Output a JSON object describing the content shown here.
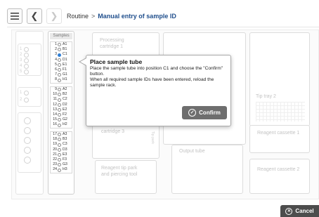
{
  "nav": {
    "menu_icon": "hamburger-menu-icon",
    "back_icon": "chevron-left-icon",
    "forward_icon": "chevron-right-icon"
  },
  "breadcrumb": {
    "root": "Routine",
    "separator": ">",
    "current": "Manual entry of sample ID"
  },
  "samples_panel": {
    "title": "Samples",
    "groups": [
      [
        {
          "n": "1",
          "pos": "A1"
        },
        {
          "n": "2",
          "pos": "B1"
        },
        {
          "n": "3",
          "pos": "C1",
          "active": true
        },
        {
          "n": "4",
          "pos": "D1"
        },
        {
          "n": "5",
          "pos": "E1"
        },
        {
          "n": "6",
          "pos": "F1"
        },
        {
          "n": "7",
          "pos": "G1"
        },
        {
          "n": "8",
          "pos": "H1"
        }
      ],
      [
        {
          "n": "9",
          "pos": "A2"
        },
        {
          "n": "10",
          "pos": "B2"
        },
        {
          "n": "11",
          "pos": "C2"
        },
        {
          "n": "12",
          "pos": "D2"
        },
        {
          "n": "13",
          "pos": "E2"
        },
        {
          "n": "14",
          "pos": "F2"
        },
        {
          "n": "15",
          "pos": "G2"
        },
        {
          "n": "16",
          "pos": "H2"
        }
      ],
      [
        {
          "n": "17",
          "pos": "A3"
        },
        {
          "n": "18",
          "pos": "B3"
        },
        {
          "n": "19",
          "pos": "C3"
        },
        {
          "n": "20",
          "pos": "D3"
        },
        {
          "n": "21",
          "pos": "E3"
        },
        {
          "n": "22",
          "pos": "F3"
        },
        {
          "n": "23",
          "pos": "G3"
        },
        {
          "n": "24",
          "pos": "H3"
        }
      ]
    ],
    "active_color": "#2f7fd6"
  },
  "modules": {
    "processing_cartridge_1": "Processing cartridge 1",
    "processing_cartridge_3": "cartridge 3",
    "tip_park": "Tip park",
    "tip_tray_2": "Tip tray 2",
    "reagent_cassette_1": "Reagent cassette 1",
    "reagent_cassette_2": "Reagent cassette 2",
    "output_tube": "Output tube",
    "reagent_tip_park": "Reagent tip park and piercing tool"
  },
  "dialog": {
    "title": "Place sample tube",
    "line1": "Place the sample tube into position C1 and choose the \"Confirm\" button.",
    "line2": "When all required sample IDs have been entered, reload the sample rack.",
    "confirm_label": "Confirm",
    "confirm_icon": "check-circle-icon"
  },
  "footer": {
    "cancel_label": "Cancel",
    "cancel_icon": "x-circle-icon"
  },
  "colors": {
    "breadcrumb_current": "#1f4e8c",
    "confirm_button": "#6e6e6e",
    "cancel_button": "#4d4d4d"
  }
}
